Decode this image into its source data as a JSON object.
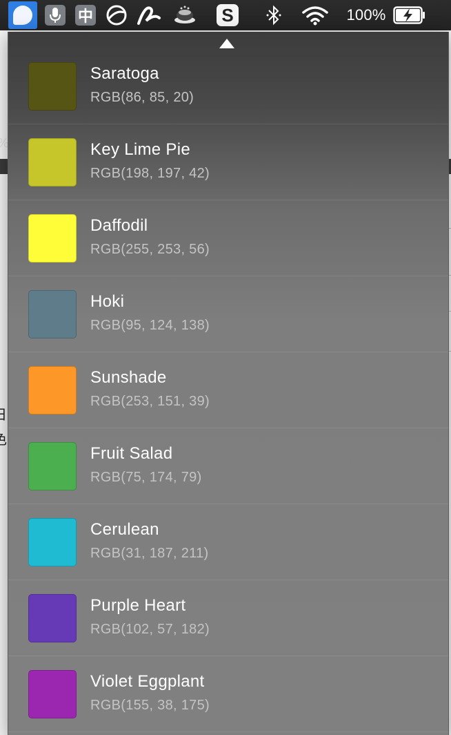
{
  "menubar": {
    "icons": [
      "app-dot-icon",
      "microphone-icon",
      "chinese-input-icon",
      "circle-slash-icon",
      "pen-swoosh-icon",
      "tray-icon",
      "s-app-icon",
      "bluetooth-icon",
      "wifi-icon",
      "battery-charging-icon"
    ],
    "battery_percent": "100%"
  },
  "background": {
    "glyph_left_1": "日",
    "glyph_left_2": "色",
    "glyph_percent": "%"
  },
  "colors": [
    {
      "name": "Saratoga",
      "rgb": "RGB(86, 85, 20)",
      "hex": "#565514"
    },
    {
      "name": "Key Lime Pie",
      "rgb": "RGB(198, 197, 42)",
      "hex": "#C6C52A"
    },
    {
      "name": "Daffodil",
      "rgb": "RGB(255, 253, 56)",
      "hex": "#FFFD38"
    },
    {
      "name": "Hoki",
      "rgb": "RGB(95, 124, 138)",
      "hex": "#5F7C8A"
    },
    {
      "name": "Sunshade",
      "rgb": "RGB(253, 151, 39)",
      "hex": "#FD9727"
    },
    {
      "name": "Fruit Salad",
      "rgb": "RGB(75, 174, 79)",
      "hex": "#4BAE4F"
    },
    {
      "name": "Cerulean",
      "rgb": "RGB(31, 187, 211)",
      "hex": "#1FBBD3"
    },
    {
      "name": "Purple Heart",
      "rgb": "RGB(102, 57, 182)",
      "hex": "#6639B6"
    },
    {
      "name": "Violet Eggplant",
      "rgb": "RGB(155, 38, 175)",
      "hex": "#9B26AF"
    }
  ]
}
